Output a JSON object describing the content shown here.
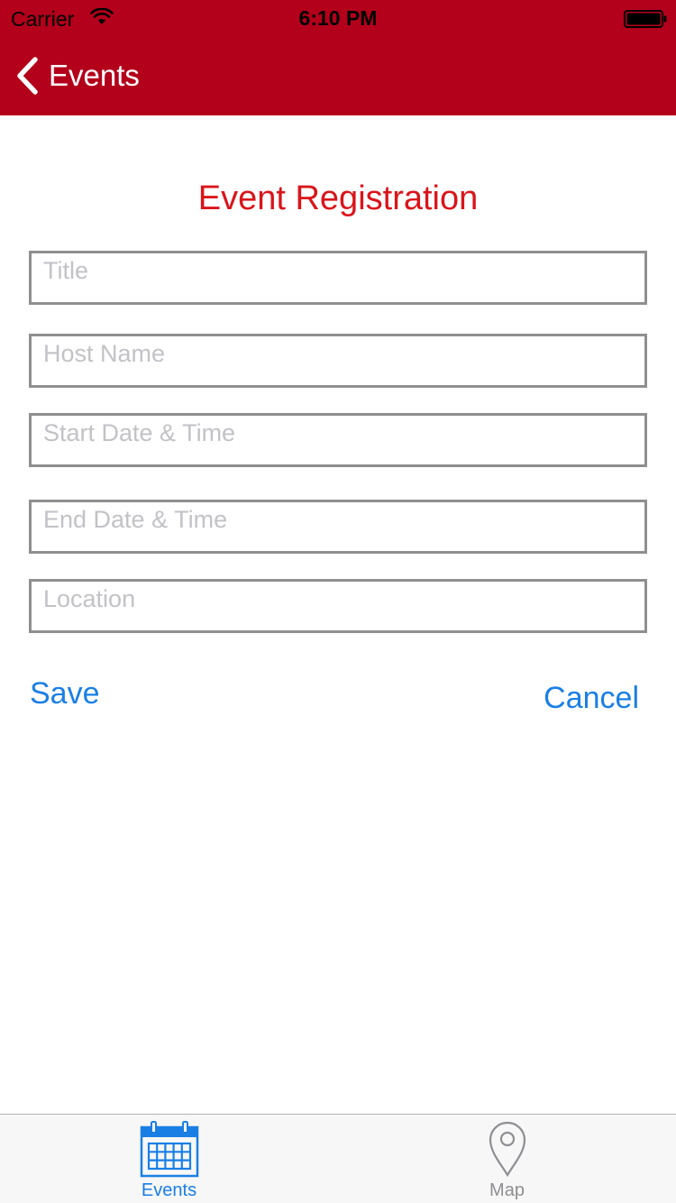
{
  "status_bar": {
    "carrier": "Carrier",
    "time": "6:10 PM"
  },
  "nav": {
    "back_label": "Events"
  },
  "form": {
    "title": "Event Registration",
    "fields": [
      {
        "placeholder": "Title",
        "value": ""
      },
      {
        "placeholder": "Host Name",
        "value": ""
      },
      {
        "placeholder": "Start Date & Time",
        "value": ""
      },
      {
        "placeholder": "End Date & Time",
        "value": ""
      },
      {
        "placeholder": "Location",
        "value": ""
      }
    ],
    "save_label": "Save",
    "cancel_label": "Cancel"
  },
  "tabbar": {
    "tabs": [
      {
        "label": "Events",
        "icon": "calendar-icon",
        "selected": true
      },
      {
        "label": "Map",
        "icon": "map-pin-icon",
        "selected": false
      }
    ]
  },
  "colors": {
    "brand_red": "#b3001b",
    "title_red": "#d9151b",
    "accent_blue": "#1a7fe5",
    "inactive_gray": "#8e8e93"
  }
}
